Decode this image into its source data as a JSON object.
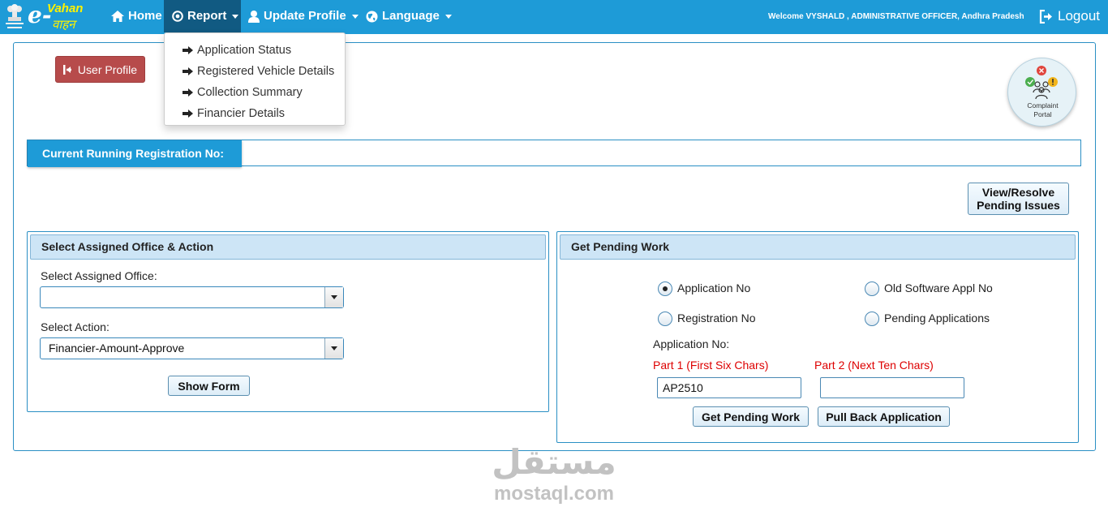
{
  "nav": {
    "logo_e": "e-",
    "logo_vahan": "Vahan",
    "logo_sub": "वाहन",
    "home": "Home",
    "report": "Report",
    "update_profile": "Update Profile",
    "language": "Language",
    "welcome": "Welcome VYSHALD , ADMINISTRATIVE OFFICER, Andhra Pradesh",
    "logout": "Logout"
  },
  "report_menu": {
    "items": [
      {
        "label": "Application Status"
      },
      {
        "label": "Registered Vehicle Details"
      },
      {
        "label": "Collection Summary"
      },
      {
        "label": "Financier Details"
      }
    ]
  },
  "main": {
    "user_profile": "User Profile",
    "complaint_line1": "Complaint",
    "complaint_line2": "Portal",
    "current_reg_label": "Current Running Registration No:",
    "current_reg_value": "",
    "view_resolve_line1": "View/Resolve",
    "view_resolve_line2": "Pending Issues"
  },
  "office_panel": {
    "title": "Select Assigned Office & Action",
    "office_label": "Select Assigned Office:",
    "office_value": "",
    "action_label": "Select Action:",
    "action_value": "Financier-Amount-Approve",
    "show_form": "Show Form"
  },
  "pending_panel": {
    "title": "Get Pending Work",
    "radio_application_no": "Application No",
    "radio_old_software": "Old Software Appl No",
    "radio_registration_no": "Registration No",
    "radio_pending_apps": "Pending Applications",
    "selected_radio": "Application No",
    "app_no_label": "Application No:",
    "part1_label": "Part 1 (First Six Chars)",
    "part2_label": "Part 2 (Next Ten Chars)",
    "part1_value": "AP2510",
    "part2_value": "",
    "get_pending_work": "Get Pending Work",
    "pull_back": "Pull Back Application"
  },
  "watermark": {
    "arabic": "مستقل",
    "latin": "mostaql.com"
  },
  "colors": {
    "navbar": "#1e9bd7",
    "nav_active": "#115a82",
    "user_profile_btn": "#b74b4b",
    "panel_header": "#cde5f6",
    "required_label": "#dd0000"
  }
}
